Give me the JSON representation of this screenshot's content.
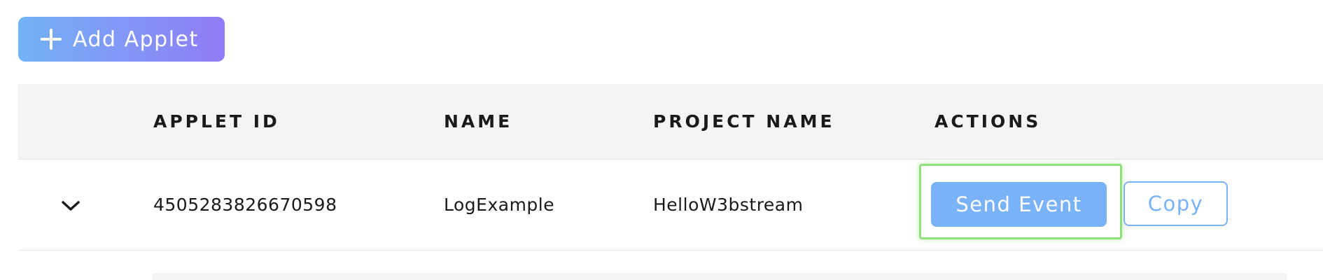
{
  "toolbar": {
    "add_label": "Add Applet",
    "add_icon": "plus-icon"
  },
  "table": {
    "columns": [
      "APPLET ID",
      "NAME",
      "PROJECT NAME",
      "ACTIONS"
    ],
    "rows": [
      {
        "expand_icon": "chevron-down-icon",
        "applet_id": "4505283826670598",
        "name": "LogExample",
        "project_name": "HelloW3bstream",
        "actions": {
          "send_event": "Send Event",
          "copy": "Copy"
        }
      }
    ]
  },
  "colors": {
    "add_gradient_start": "#73b2f5",
    "add_gradient_end": "#8f7cf6",
    "primary_blue": "#79b2f6",
    "highlight_green": "#8ee07a",
    "header_bg": "#f4f4f4"
  }
}
